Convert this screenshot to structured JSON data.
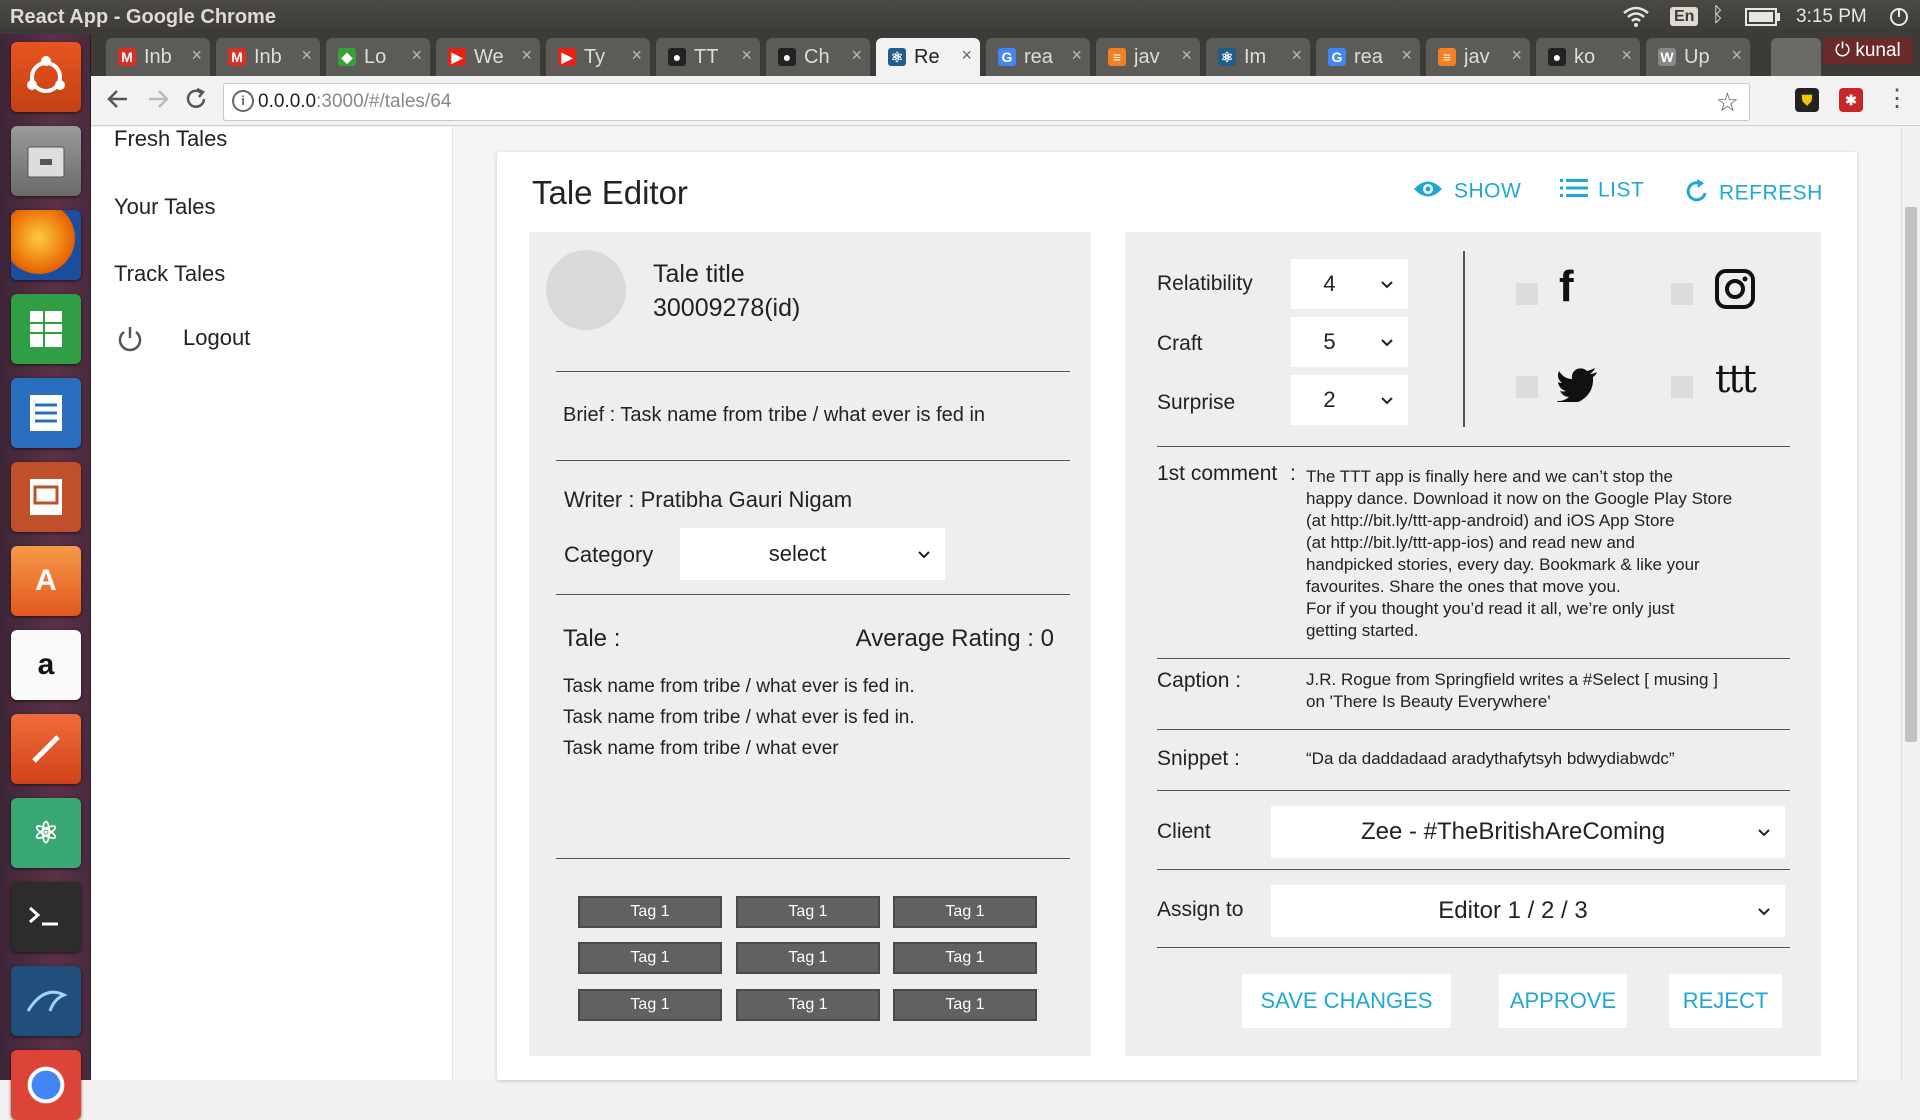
{
  "os": {
    "window_title": "React App - Google Chrome",
    "input_lang": "En",
    "clock": "3:15 PM"
  },
  "browser": {
    "profile": "kunal",
    "tabs": [
      {
        "label": "Inb",
        "favicon": "gmail",
        "color": "#d93025",
        "glyph": "M"
      },
      {
        "label": "Inb",
        "favicon": "gmail",
        "color": "#d93025",
        "glyph": "M"
      },
      {
        "label": "Lo",
        "favicon": "cube",
        "color": "#3a9e3a",
        "glyph": "◆"
      },
      {
        "label": "We",
        "favicon": "youtube",
        "color": "#e62117",
        "glyph": "▶"
      },
      {
        "label": "Ty",
        "favicon": "youtube",
        "color": "#e62117",
        "glyph": "▶"
      },
      {
        "label": "TT",
        "favicon": "github",
        "color": "#222222",
        "glyph": "●"
      },
      {
        "label": "Ch",
        "favicon": "github",
        "color": "#222222",
        "glyph": "●"
      },
      {
        "label": "Re",
        "favicon": "react",
        "color": "#1f5d8a",
        "glyph": "⚛",
        "active": true
      },
      {
        "label": "rea",
        "favicon": "google",
        "color": "#4285f4",
        "glyph": "G"
      },
      {
        "label": "jav",
        "favicon": "stackoverflow",
        "color": "#f48024",
        "glyph": "≡"
      },
      {
        "label": "Im",
        "favicon": "react",
        "color": "#1f5d8a",
        "glyph": "⚛"
      },
      {
        "label": "rea",
        "favicon": "google",
        "color": "#4285f4",
        "glyph": "G"
      },
      {
        "label": "jav",
        "favicon": "stackoverflow",
        "color": "#f48024",
        "glyph": "≡"
      },
      {
        "label": "ko",
        "favicon": "github",
        "color": "#222222",
        "glyph": "●"
      },
      {
        "label": "Up",
        "favicon": "wikipedia",
        "color": "#888888",
        "glyph": "W"
      }
    ],
    "url_host": "0.0.0.0",
    "url_rest": ":3000/#/tales/64"
  },
  "sidebar": {
    "items": [
      "Fresh Tales",
      "Your Tales",
      "Track Tales"
    ],
    "logout": "Logout"
  },
  "header": {
    "title": "Tale Editor",
    "show": "SHOW",
    "list": "LIST",
    "refresh": "REFRESH"
  },
  "left": {
    "title": "Tale title",
    "id": "30009278(id)",
    "brief": "Brief : Task name from tribe / what ever is fed in",
    "writer": "Writer : Pratibha Gauri Nigam",
    "category_label": "Category",
    "category_value": "select",
    "tale_label": "Tale :",
    "avg_rating": "Average Rating : 0",
    "tale_lines": [
      "Task name from tribe / what ever is fed in.",
      "Task name from tribe / what ever is fed in.",
      "Task name from tribe / what ever"
    ],
    "tags": [
      "Tag 1",
      "Tag 1",
      "Tag 1",
      "Tag 1",
      "Tag 1",
      "Tag 1",
      "Tag 1",
      "Tag 1",
      "Tag 1"
    ]
  },
  "right": {
    "ratings": [
      {
        "label": "Relatibility",
        "value": "4"
      },
      {
        "label": "Craft",
        "value": "5"
      },
      {
        "label": "Surprise",
        "value": "2"
      }
    ],
    "social": {
      "facebook_glyph": "f",
      "ttt_glyph": "ttt"
    },
    "comment_label": "1st comment",
    "comment_sep": ":",
    "comment_lines": [
      "The TTT app is finally here and we can’t stop the",
      "happy dance. Download it now on the Google Play Store",
      "(at http://bit.ly/ttt-app-android) and iOS App Store",
      "(at http://bit.ly/ttt-app-ios) and read new and",
      "handpicked stories, every day. Bookmark & like your",
      "favourites. Share the ones that move you.",
      "For if you thought you’d read it all, we’re only just",
      "getting started."
    ],
    "caption_label": "Caption :",
    "caption_lines": [
      "J.R. Rogue from Springfield writes a #Select [ musing ]",
      "on 'There Is Beauty Everywhere'"
    ],
    "snippet_label": "Snippet :",
    "snippet": "“Da da daddadaad aradythafytsyh bdwydiabwdc”",
    "client_label": "Client",
    "client_value": "Zee - #TheBritishAreComing",
    "assign_label": "Assign to",
    "assign_value": "Editor 1 / 2 / 3",
    "save": "SAVE CHANGES",
    "approve": "APPROVE",
    "reject": "REJECT"
  },
  "colors": {
    "accent": "#1fa8d6",
    "tag_bg": "#616161",
    "panel_bg": "#eeeeee"
  }
}
